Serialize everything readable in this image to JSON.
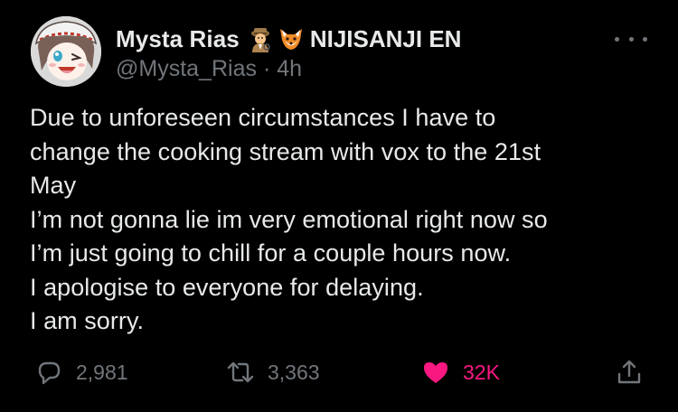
{
  "tweet": {
    "author": {
      "display_name": "Mysta Rias",
      "emoji_1": "detective-emoji",
      "emoji_2": "fox-emoji",
      "affiliation": "NIJISANJI EN",
      "handle": "@Mysta_Rias",
      "separator": "·",
      "time": "4h"
    },
    "more_icon": "more-dots-icon",
    "text_lines": [
      "Due to unforeseen circumstances I have to",
      "change the cooking stream with vox to the 21st",
      "May",
      "I’m not gonna lie im very emotional right now so",
      "I’m just going to chill for a couple hours now.",
      "I apologise to everyone for delaying.",
      "I am sorry."
    ],
    "actions": {
      "reply": {
        "icon": "reply-icon",
        "count": "2,981"
      },
      "retweet": {
        "icon": "retweet-icon",
        "count": "3,363"
      },
      "like": {
        "icon": "heart-icon",
        "count": "32K",
        "liked": true
      },
      "share": {
        "icon": "share-icon"
      }
    }
  },
  "colors": {
    "background": "#000000",
    "text": "#e7e9ea",
    "muted": "#71767b",
    "like": "#f91880"
  }
}
